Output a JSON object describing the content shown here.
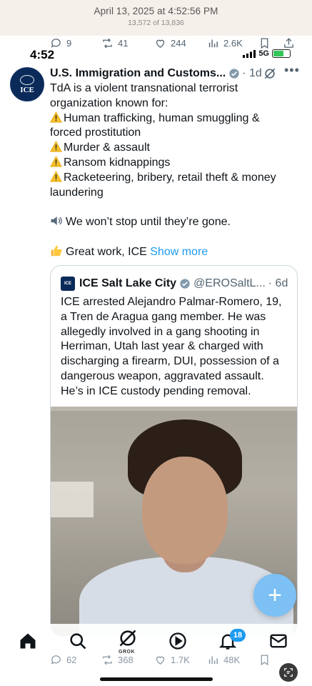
{
  "photos": {
    "date": "April 13, 2025 at 4:52:56 PM",
    "count": "13,572 of 13,836"
  },
  "prev_tweet_actions": {
    "replies": "9",
    "reposts": "41",
    "likes": "244",
    "views": "2.6K"
  },
  "status_bar": {
    "time": "4:52",
    "network": "5G"
  },
  "tweet": {
    "author": "U.S. Immigration and Customs...",
    "age": "1d",
    "avatar_label": "ICE",
    "lines": [
      {
        "icon": "",
        "text": "TdA is a violent transnational terrorist"
      },
      {
        "icon": "",
        "text": "organization known for:"
      },
      {
        "icon": "warning-icon",
        "text": "Human trafficking, human smuggling &"
      },
      {
        "icon": "",
        "text": "forced prostitution"
      },
      {
        "icon": "warning-icon",
        "text": "Murder & assault"
      },
      {
        "icon": "warning-icon",
        "text": "Ransom kidnappings"
      },
      {
        "icon": "warning-icon",
        "text": "Racketeering, bribery, retail theft & money"
      },
      {
        "icon": "",
        "text": "laundering"
      },
      {
        "icon": "",
        "text": ""
      },
      {
        "icon": "speaker-icon",
        "text": "We won’t stop until they’re gone."
      },
      {
        "icon": "",
        "text": ""
      },
      {
        "icon": "thumbs-up-icon",
        "text": "Great work, ICE"
      }
    ],
    "show_more": "Show more"
  },
  "quote": {
    "author": "ICE Salt Lake City",
    "handle": "@EROSaltL...",
    "age": "· 6d",
    "avatar_label": "ICE",
    "lines": [
      "ICE arrested Alejandro Palmar-Romero, 19,",
      "a Tren de Aragua gang member. He was",
      "allegedly involved in a gang shooting in",
      "Herriman, Utah last year  & charged with",
      "discharging a firearm, DUI, possession of a",
      "dangerous weapon, aggravated assault.",
      "He’s in ICE custody pending removal."
    ]
  },
  "fab": {
    "label": "+"
  },
  "bottom_nav": {
    "grok_label": "GROK",
    "notifications_badge": "18"
  },
  "bottom_actions": {
    "replies": "62",
    "reposts": "368",
    "likes": "1.7K",
    "views": "48K"
  },
  "colors": {
    "accent": "#1d9bf0",
    "fab": "#7cc0f4",
    "verified": "#829aab",
    "ice_navy": "#0a2a5a"
  }
}
